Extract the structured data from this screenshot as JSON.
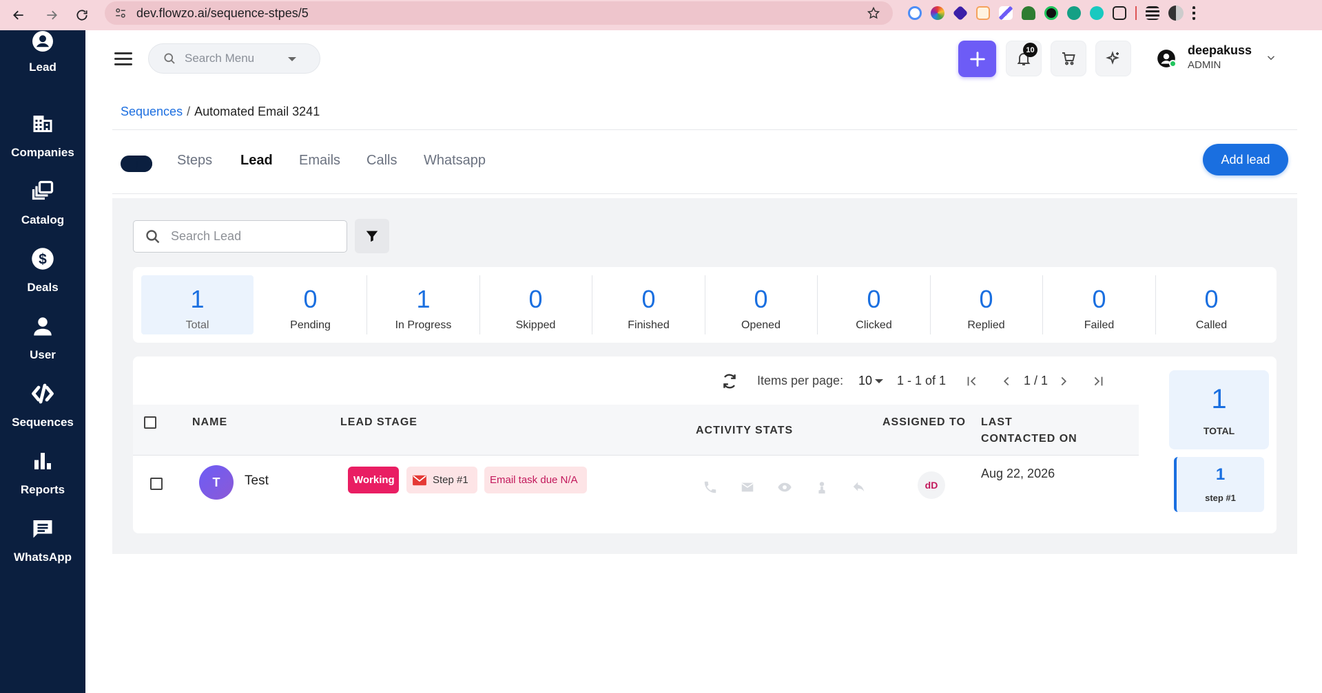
{
  "browser": {
    "url": "dev.flowzo.ai/sequence-stpes/5"
  },
  "sidebar": {
    "items": [
      {
        "label": "Lead",
        "icon": "lead-icon"
      },
      {
        "label": "Companies",
        "icon": "companies-icon"
      },
      {
        "label": "Catalog",
        "icon": "catalog-icon"
      },
      {
        "label": "Deals",
        "icon": "deals-icon"
      },
      {
        "label": "User",
        "icon": "user-icon"
      },
      {
        "label": "Sequences",
        "icon": "sequences-icon"
      },
      {
        "label": "Reports",
        "icon": "reports-icon"
      },
      {
        "label": "WhatsApp",
        "icon": "whatsapp-icon"
      }
    ]
  },
  "header": {
    "search_placeholder": "Search Menu",
    "notification_count": "10",
    "user_name": "deepakuss",
    "user_role": "ADMIN"
  },
  "breadcrumb": {
    "parent": "Sequences",
    "separator": "/",
    "current": "Automated Email 3241"
  },
  "tabs": [
    {
      "label": "Steps",
      "active": false
    },
    {
      "label": "Lead",
      "active": true
    },
    {
      "label": "Emails",
      "active": false
    },
    {
      "label": "Calls",
      "active": false
    },
    {
      "label": "Whatsapp",
      "active": false
    }
  ],
  "add_lead_label": "Add lead",
  "lead_search_placeholder": "Search Lead",
  "stats": [
    {
      "value": "1",
      "label": "Total"
    },
    {
      "value": "0",
      "label": "Pending"
    },
    {
      "value": "1",
      "label": "In Progress"
    },
    {
      "value": "0",
      "label": "Skipped"
    },
    {
      "value": "0",
      "label": "Finished"
    },
    {
      "value": "0",
      "label": "Opened"
    },
    {
      "value": "0",
      "label": "Clicked"
    },
    {
      "value": "0",
      "label": "Replied"
    },
    {
      "value": "0",
      "label": "Failed"
    },
    {
      "value": "0",
      "label": "Called"
    }
  ],
  "pagination": {
    "items_per_page_label": "Items per page:",
    "items_per_page": "10",
    "range": "1 - 1 of 1",
    "page": "1 / 1"
  },
  "table": {
    "columns": {
      "name": "NAME",
      "lead_stage": "LEAD STAGE",
      "activity_stats": "ACTIVITY STATS",
      "assigned_to": "ASSIGNED TO",
      "last_contacted_line1": "LAST",
      "last_contacted_line2": "CONTACTED ON"
    },
    "rows": [
      {
        "avatar_initial": "T",
        "name": "Test",
        "stage": "Working",
        "step": "Step #1",
        "task": "Email task due N/A",
        "assigned": "dD",
        "last_contacted": "Aug 22, 2026"
      }
    ]
  },
  "summary": {
    "total_value": "1",
    "total_label": "TOTAL",
    "step_value": "1",
    "step_label": "step #1"
  },
  "colors": {
    "sidebar": "#0b1f3f",
    "accent_blue": "#1a6fe0",
    "accent_purple": "#6d5cf6",
    "working_pink": "#e91e63"
  }
}
